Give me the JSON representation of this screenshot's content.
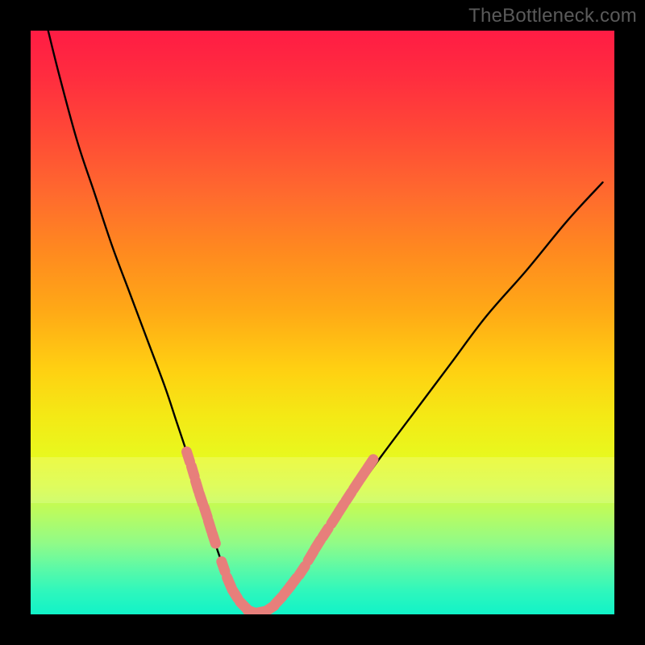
{
  "watermark": "TheBottleneck.com",
  "colors": {
    "curve": "#000000",
    "marker_fill": "#e77f7b",
    "marker_stroke": "#d96f6b",
    "frame": "#000000"
  },
  "chart_data": {
    "type": "line",
    "title": "",
    "xlabel": "",
    "ylabel": "",
    "xlim": [
      0,
      100
    ],
    "ylim": [
      0,
      100
    ],
    "grid": false,
    "legend": false,
    "series": [
      {
        "name": "bottleneck-curve",
        "x": [
          3,
          5,
          8,
          11,
          14,
          17,
          20,
          23,
          25,
          27,
          29,
          30.5,
          32,
          33.5,
          35,
          37,
          39,
          41,
          43,
          46,
          50,
          55,
          60,
          66,
          72,
          78,
          85,
          92,
          98
        ],
        "values": [
          100,
          92,
          81,
          72,
          63,
          55,
          47,
          39,
          33,
          27,
          21,
          16,
          11,
          7,
          3.5,
          1,
          0.2,
          1,
          3,
          7,
          13,
          20,
          27,
          35,
          43,
          51,
          59,
          67.5,
          74
        ],
        "comment": "V-shaped curve; minimum ~0 at x≈39, steep left arm, shallower right arm"
      }
    ],
    "markers": {
      "name": "highlight-dots",
      "comment": "Salmon rounded markers clustered along lower portion of both arms near the minimum",
      "points": [
        {
          "x": 27.0,
          "y": 27.0
        },
        {
          "x": 27.8,
          "y": 24.5
        },
        {
          "x": 28.5,
          "y": 22.0
        },
        {
          "x": 29.2,
          "y": 19.8
        },
        {
          "x": 30.0,
          "y": 17.5
        },
        {
          "x": 30.7,
          "y": 15.2
        },
        {
          "x": 31.4,
          "y": 13.0
        },
        {
          "x": 33.0,
          "y": 8.2
        },
        {
          "x": 34.0,
          "y": 5.5
        },
        {
          "x": 35.0,
          "y": 3.5
        },
        {
          "x": 36.5,
          "y": 1.5
        },
        {
          "x": 38.0,
          "y": 0.4
        },
        {
          "x": 39.5,
          "y": 0.4
        },
        {
          "x": 41.0,
          "y": 1.0
        },
        {
          "x": 42.5,
          "y": 2.4
        },
        {
          "x": 44.0,
          "y": 4.2
        },
        {
          "x": 45.0,
          "y": 5.5
        },
        {
          "x": 46.5,
          "y": 7.5
        },
        {
          "x": 48.0,
          "y": 10.0
        },
        {
          "x": 49.2,
          "y": 12.0
        },
        {
          "x": 50.5,
          "y": 14.0
        },
        {
          "x": 52.0,
          "y": 16.3
        },
        {
          "x": 53.2,
          "y": 18.2
        },
        {
          "x": 54.5,
          "y": 20.2
        },
        {
          "x": 55.8,
          "y": 22.2
        },
        {
          "x": 57.0,
          "y": 24.0
        },
        {
          "x": 58.2,
          "y": 25.8
        }
      ]
    },
    "bands": [
      {
        "name": "light-band",
        "y_from": 19,
        "y_to": 27,
        "opacity": 0.45
      }
    ]
  }
}
